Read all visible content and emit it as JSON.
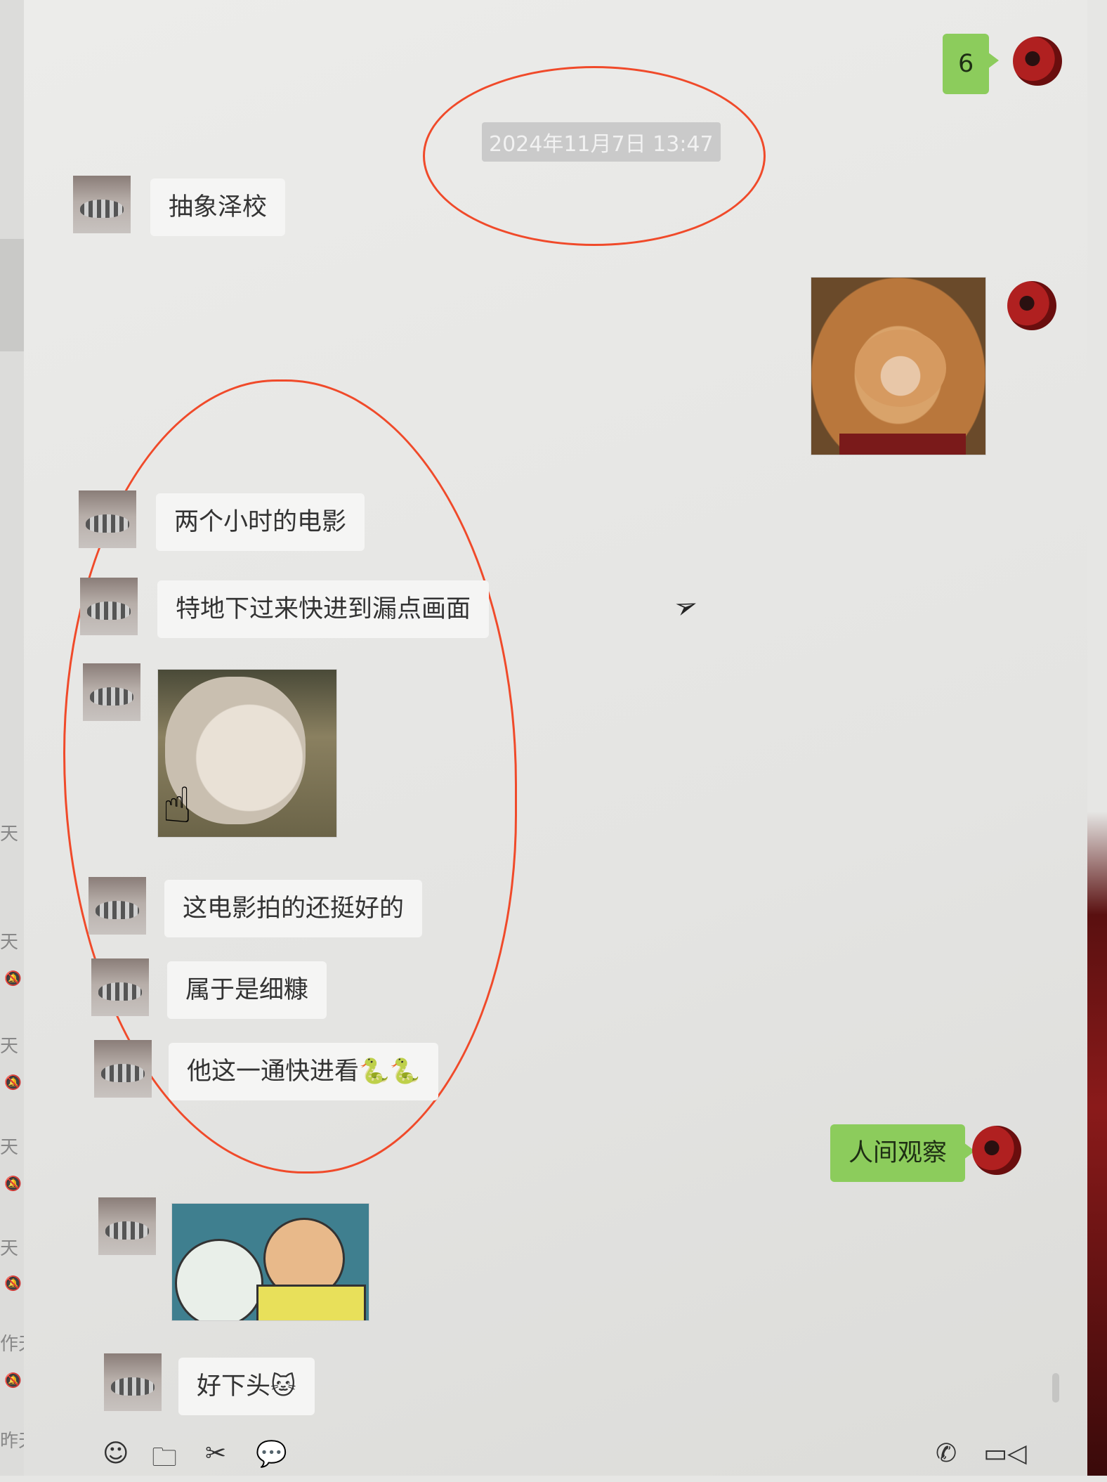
{
  "left_strip": {
    "dates": [
      "天",
      "天",
      "天",
      "天",
      "天",
      "天",
      "作天",
      "昨天"
    ]
  },
  "chat": {
    "timestamp": "2024年11月7日 13:47",
    "badge_message": "6",
    "messages": [
      {
        "from": "them",
        "text": "抽象泽校"
      },
      {
        "from": "me",
        "type": "sticker",
        "icon": "smiling-cat-sticker"
      },
      {
        "from": "them",
        "text": "两个小时的电影"
      },
      {
        "from": "them",
        "text": "特地下过来快进到漏点画面"
      },
      {
        "from": "them",
        "type": "sticker",
        "icon": "pointing-cat-sticker"
      },
      {
        "from": "them",
        "text": "这电影拍的还挺好的"
      },
      {
        "from": "them",
        "text": "属于是细糠"
      },
      {
        "from": "them",
        "text": "他这一通快进看🐍🐍"
      },
      {
        "from": "me",
        "text": "人间观察"
      },
      {
        "from": "them",
        "type": "sticker",
        "icon": "doraemon-meme-sticker"
      },
      {
        "from": "them",
        "text": "好下头🐱"
      }
    ]
  },
  "toolbar": {
    "left_icons": [
      "emoji-icon",
      "folder-icon",
      "scissors-icon",
      "chat-bubble-icon"
    ],
    "right_icons": [
      "phone-icon",
      "video-call-icon"
    ]
  },
  "colors": {
    "my_bubble": "#8ccc5c",
    "their_bubble": "#f5f5f4",
    "annotation": "#f04a2a"
  }
}
